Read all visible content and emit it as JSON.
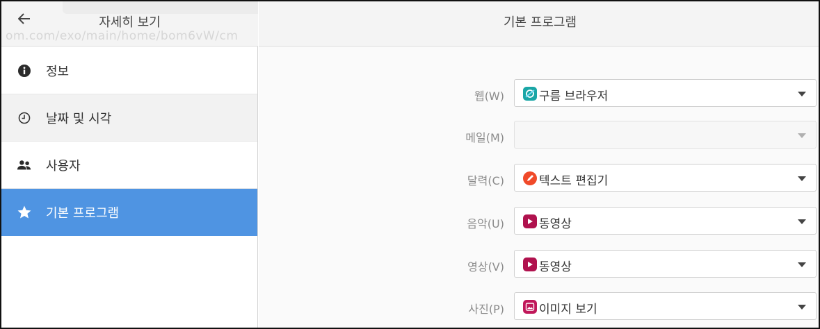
{
  "sidebar": {
    "title": "자세히 보기",
    "ghost_text": "om.com/exo/main/home/bom6vW/cm",
    "items": [
      {
        "label": "정보",
        "icon": "info-icon"
      },
      {
        "label": "날짜 및 시각",
        "icon": "clock-icon"
      },
      {
        "label": "사용자",
        "icon": "users-icon"
      },
      {
        "label": "기본 프로그램",
        "icon": "star-icon",
        "active": true
      }
    ]
  },
  "main": {
    "title": "기본 프로그램",
    "rows": [
      {
        "label": "웹(W)",
        "value": "구름 브라우저",
        "icon": "browser-icon",
        "icon_color": "#1aa6a6"
      },
      {
        "label": "메일(M)",
        "value": "",
        "disabled": true
      },
      {
        "label": "달력(C)",
        "value": "텍스트 편집기",
        "icon": "text-editor-icon",
        "icon_color": "#f04a2a"
      },
      {
        "label": "음악(U)",
        "value": "동영상",
        "icon": "video-icon",
        "icon_color": "#b0124e"
      },
      {
        "label": "영상(V)",
        "value": "동영상",
        "icon": "video-icon",
        "icon_color": "#b0124e"
      },
      {
        "label": "사진(P)",
        "value": "이미지 보기",
        "icon": "image-viewer-icon",
        "icon_color": "#c0185a"
      }
    ]
  },
  "colors": {
    "active_bg": "#4f94e2",
    "header_bg": "#f4f4f4"
  }
}
